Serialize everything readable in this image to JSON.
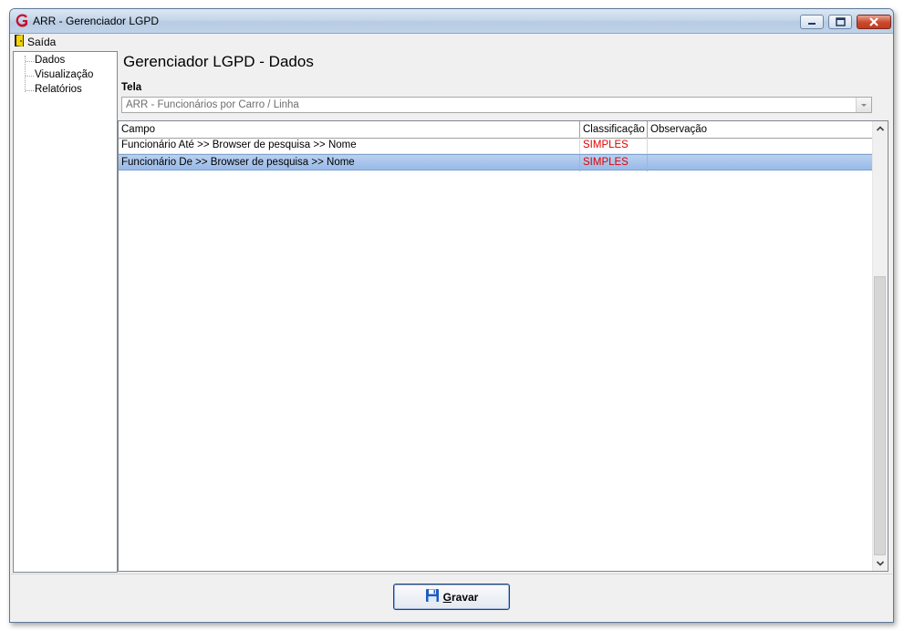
{
  "window": {
    "title": "ARR - Gerenciador LGPD"
  },
  "menu": {
    "exit_label": "Saída"
  },
  "sidebar": {
    "items": [
      {
        "label": "Dados"
      },
      {
        "label": "Visualização"
      },
      {
        "label": "Relatórios"
      }
    ]
  },
  "main": {
    "heading": "Gerenciador LGPD - Dados",
    "tela_label": "Tela",
    "tela_value": "ARR - Funcionários por Carro / Linha"
  },
  "grid": {
    "columns": [
      "Campo",
      "Classificação",
      "Observação"
    ],
    "rows": [
      {
        "campo": "Funcionário Até >> Browser de pesquisa >> Nome",
        "classificacao": "SIMPLES",
        "observacao": ""
      },
      {
        "campo": "Funcionário De >> Browser de pesquisa >> Nome",
        "classificacao": "SIMPLES",
        "observacao": ""
      }
    ],
    "selected_row": 1
  },
  "footer": {
    "save_accel": "G",
    "save_rest": "ravar"
  },
  "colors": {
    "classification_text": "#e00000",
    "selection": "#a8c6ee"
  },
  "icons": {
    "app": "app-logo-icon",
    "exit": "exit-door-icon",
    "save": "floppy-disk-icon"
  }
}
